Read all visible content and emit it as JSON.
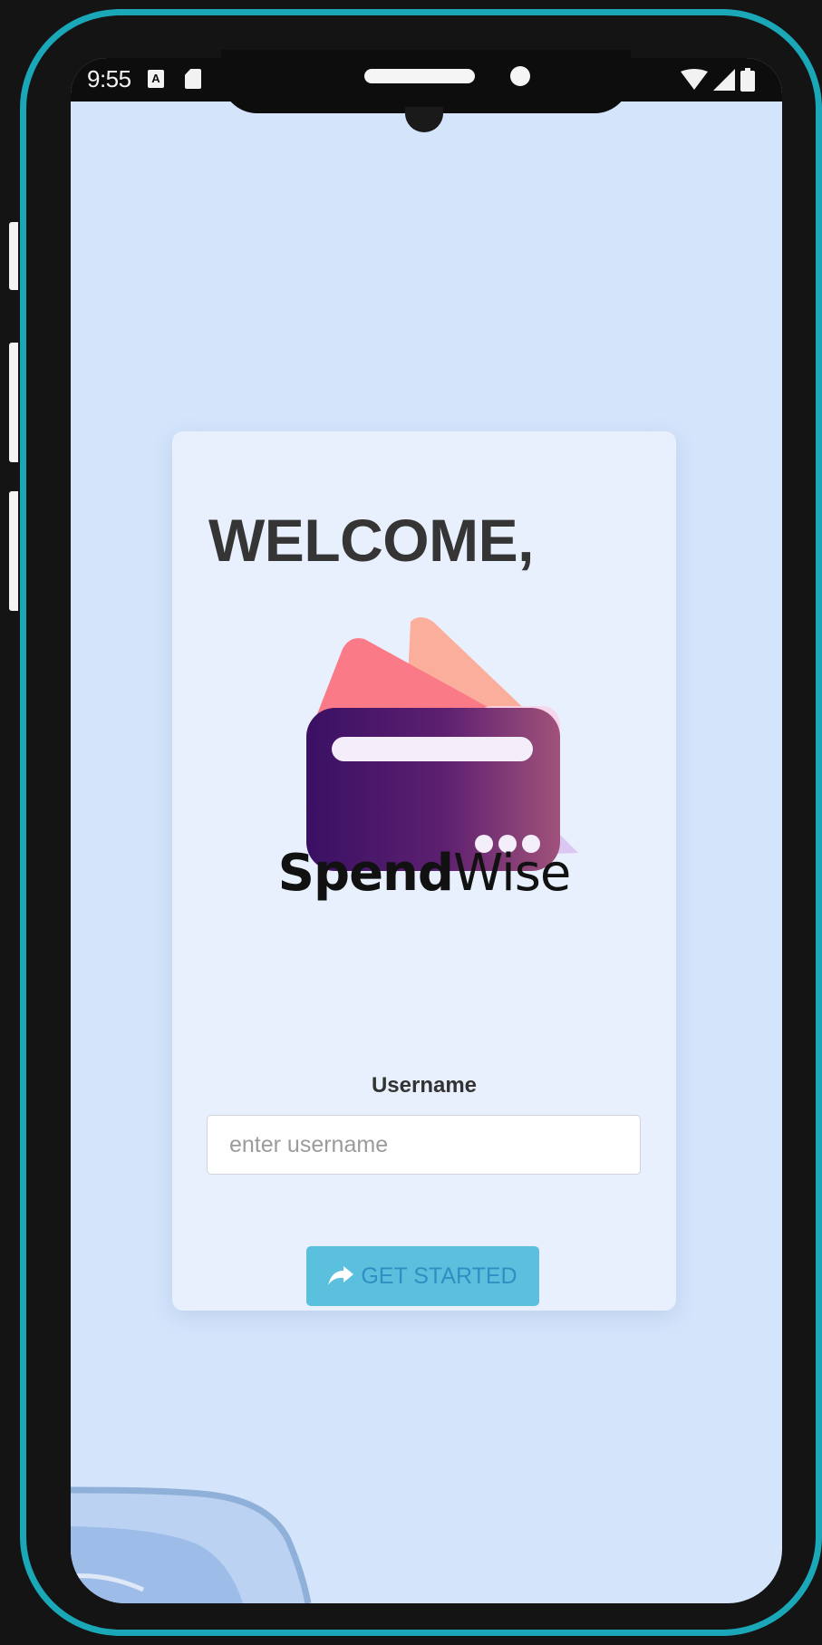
{
  "status_bar": {
    "time": "9:55",
    "left_icons": [
      "a-notification-icon",
      "sd-card-icon"
    ],
    "right_icons": [
      "wifi-icon",
      "signal-icon",
      "battery-icon"
    ]
  },
  "login_card": {
    "heading": "WELCOME,",
    "logo": {
      "brand_part1": "Spend",
      "brand_part2": "Wise"
    },
    "username_label": "Username",
    "username_placeholder": "enter username",
    "username_value": "",
    "submit_label": "GET STARTED",
    "submit_icon": "share-arrow-icon"
  },
  "colors": {
    "frame_accent": "#1aa7b8",
    "screen_background": "#d4e4fb",
    "card_background": "#e8f0fd",
    "button_background": "#5bc0de",
    "button_text": "#2f8fc1",
    "heading_text": "#353535"
  }
}
